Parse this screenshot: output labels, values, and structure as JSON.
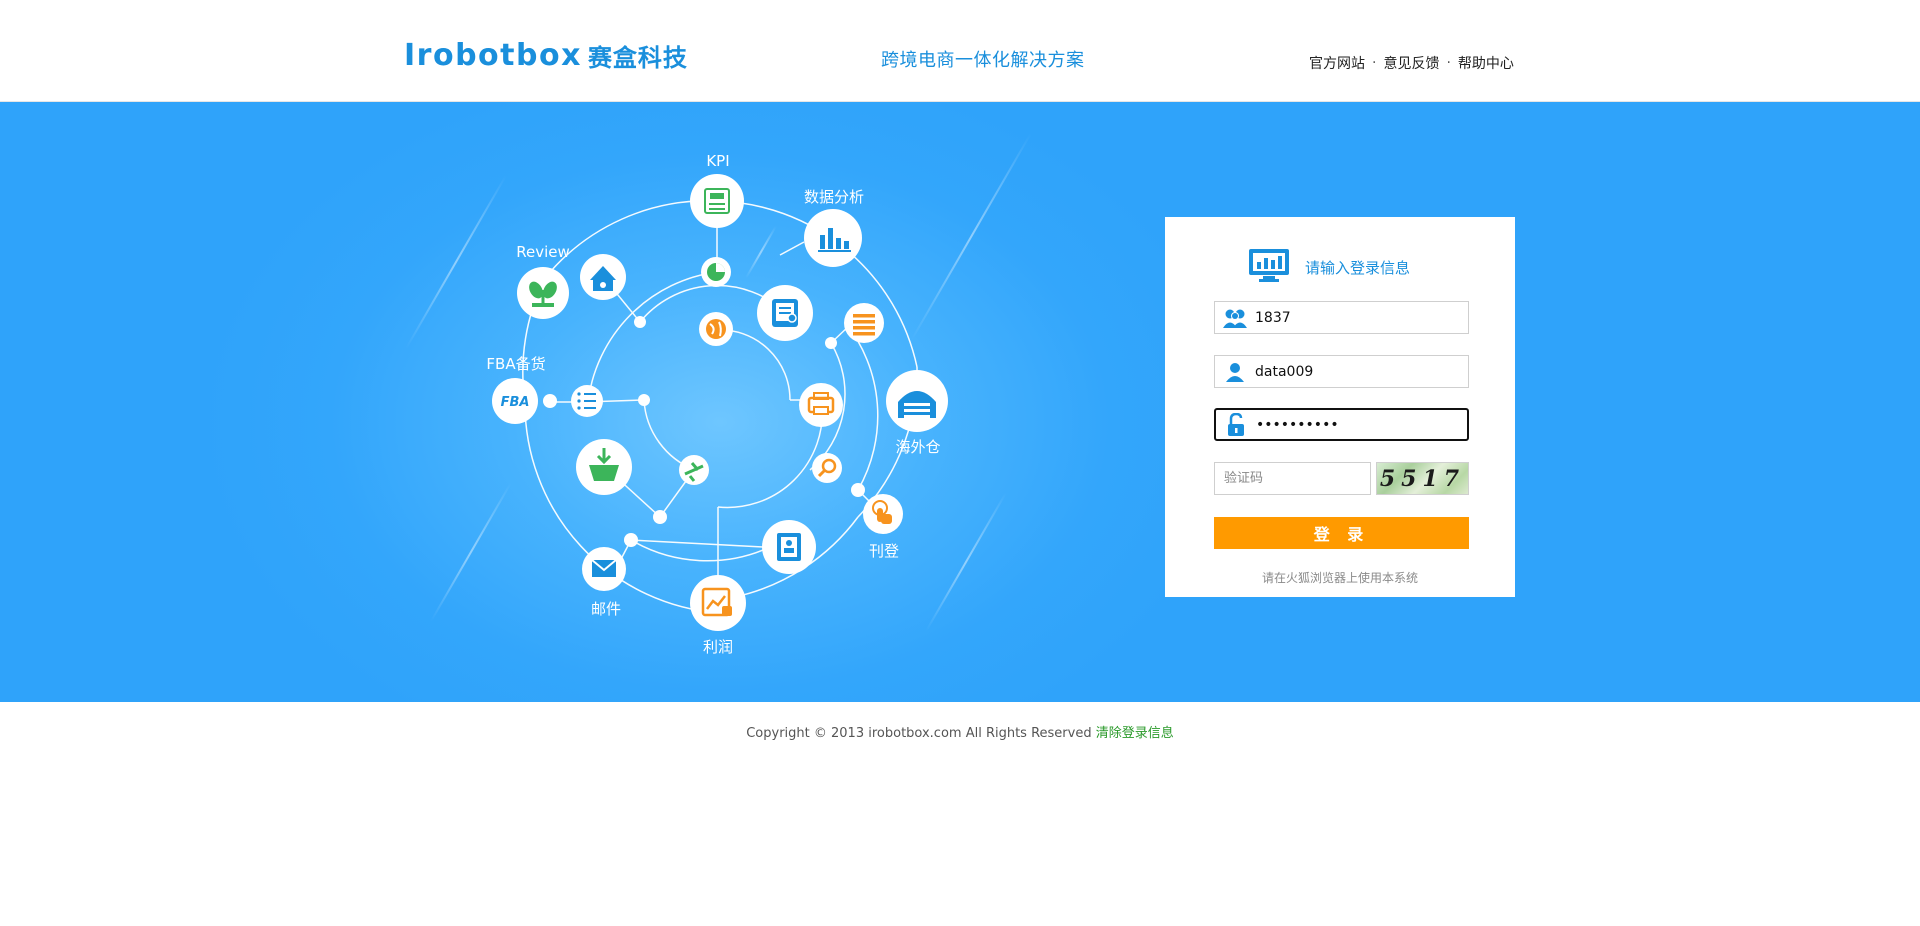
{
  "header": {
    "logo_en": "Irobotbox",
    "logo_cn": "赛盒科技",
    "slogan": "跨境电商一体化解决方案",
    "links": [
      "官方网站",
      "意见反馈",
      "帮助中心"
    ],
    "separator": "·"
  },
  "diagram": {
    "labels": {
      "kpi": "KPI",
      "data_analysis": "数据分析",
      "review": "Review",
      "fba": "FBA备货",
      "overseas_warehouse": "海外仓",
      "listing": "刊登",
      "mail": "邮件",
      "profit": "利润"
    },
    "fba_badge": "FBA",
    "colors": {
      "green": "#3cb55a",
      "blue": "#1a8fdc",
      "orange": "#f7931e"
    }
  },
  "login": {
    "title": "请输入登录信息",
    "company_id": "1837",
    "username": "data009",
    "password": "••••••••••",
    "captcha_placeholder": "验证码",
    "captcha_code": "5517",
    "submit_label": "登 录",
    "browser_note": "请在火狐浏览器上使用本系统",
    "accent": "#ff9a00"
  },
  "footer": {
    "copyright": "Copyright © 2013 irobotbox.com All Rights Reserved",
    "clear_link": "清除登录信息"
  }
}
